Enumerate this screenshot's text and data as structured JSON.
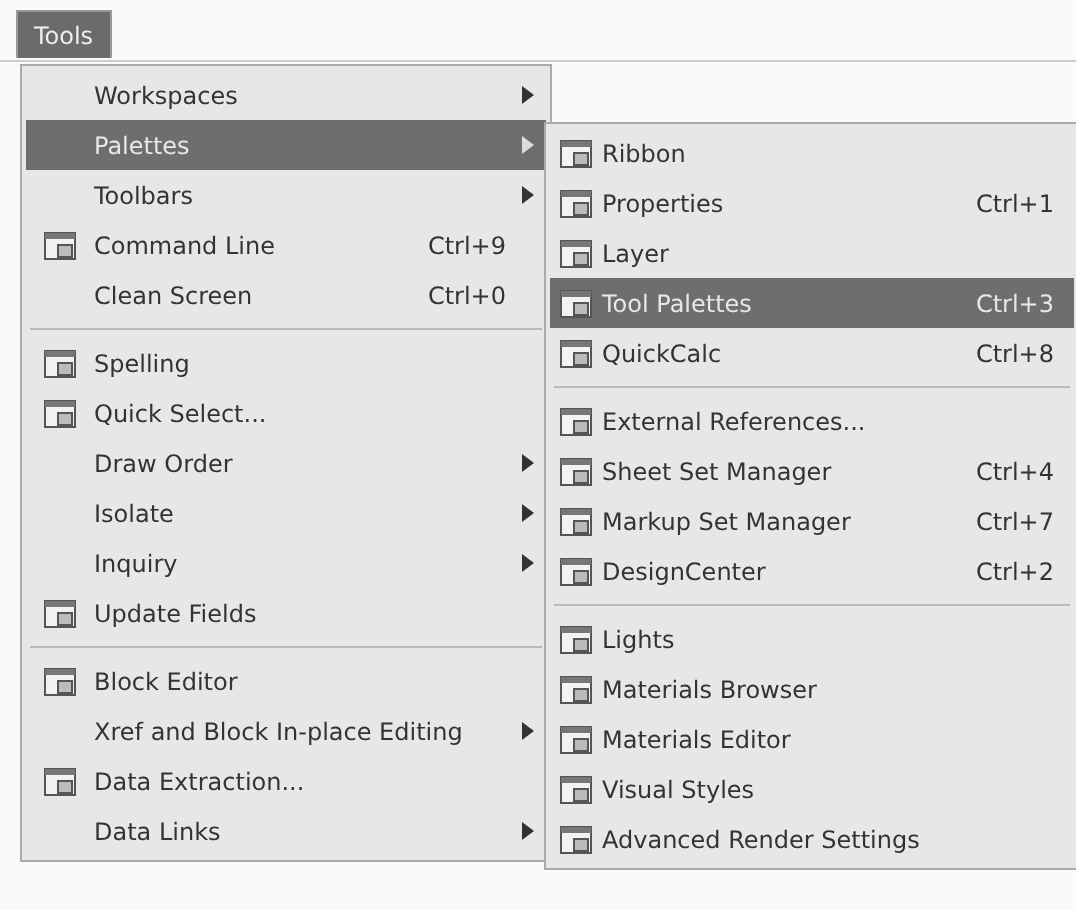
{
  "menu_bar": {
    "title": "Tools",
    "selected": true
  },
  "tools_menu": {
    "sections": [
      {
        "items": [
          {
            "label": "Workspaces",
            "has_icon": false,
            "submenu": true,
            "selected": false
          },
          {
            "label": "Palettes",
            "has_icon": false,
            "submenu": true,
            "selected": true
          },
          {
            "label": "Toolbars",
            "has_icon": false,
            "submenu": true,
            "selected": false
          },
          {
            "label": "Command Line",
            "has_icon": true,
            "shortcut": "Ctrl+9",
            "submenu": false,
            "selected": false
          },
          {
            "label": "Clean Screen",
            "has_icon": false,
            "shortcut": "Ctrl+0",
            "submenu": false,
            "selected": false
          }
        ]
      },
      {
        "items": [
          {
            "label": "Spelling",
            "has_icon": true,
            "submenu": false,
            "selected": false
          },
          {
            "label": "Quick Select...",
            "has_icon": true,
            "submenu": false,
            "selected": false
          },
          {
            "label": "Draw Order",
            "has_icon": false,
            "submenu": true,
            "selected": false
          },
          {
            "label": "Isolate",
            "has_icon": false,
            "submenu": true,
            "selected": false
          },
          {
            "label": "Inquiry",
            "has_icon": false,
            "submenu": true,
            "selected": false
          },
          {
            "label": "Update Fields",
            "has_icon": true,
            "submenu": false,
            "selected": false
          }
        ]
      },
      {
        "items": [
          {
            "label": "Block Editor",
            "has_icon": true,
            "submenu": false,
            "selected": false
          },
          {
            "label": "Xref and Block In-place Editing",
            "has_icon": false,
            "submenu": true,
            "selected": false
          },
          {
            "label": "Data Extraction...",
            "has_icon": true,
            "submenu": false,
            "selected": false
          },
          {
            "label": "Data Links",
            "has_icon": false,
            "submenu": true,
            "selected": false
          }
        ]
      }
    ]
  },
  "palettes_submenu": {
    "sections": [
      {
        "items": [
          {
            "label": "Ribbon",
            "has_icon": true,
            "selected": false
          },
          {
            "label": "Properties",
            "has_icon": true,
            "shortcut": "Ctrl+1",
            "selected": false
          },
          {
            "label": "Layer",
            "has_icon": true,
            "selected": false
          },
          {
            "label": "Tool Palettes",
            "has_icon": true,
            "shortcut": "Ctrl+3",
            "selected": true
          },
          {
            "label": "QuickCalc",
            "has_icon": true,
            "shortcut": "Ctrl+8",
            "selected": false
          }
        ]
      },
      {
        "items": [
          {
            "label": "External References...",
            "has_icon": true,
            "selected": false
          },
          {
            "label": "Sheet Set Manager",
            "has_icon": true,
            "shortcut": "Ctrl+4",
            "selected": false
          },
          {
            "label": "Markup Set Manager",
            "has_icon": true,
            "shortcut": "Ctrl+7",
            "selected": false
          },
          {
            "label": "DesignCenter",
            "has_icon": true,
            "shortcut": "Ctrl+2",
            "selected": false
          }
        ]
      },
      {
        "items": [
          {
            "label": "Lights",
            "has_icon": true,
            "selected": false
          },
          {
            "label": "Materials Browser",
            "has_icon": true,
            "selected": false
          },
          {
            "label": "Materials Editor",
            "has_icon": true,
            "selected": false
          },
          {
            "label": "Visual Styles",
            "has_icon": true,
            "selected": false
          },
          {
            "label": "Advanced Render Settings",
            "has_icon": true,
            "selected": false
          }
        ]
      }
    ]
  }
}
